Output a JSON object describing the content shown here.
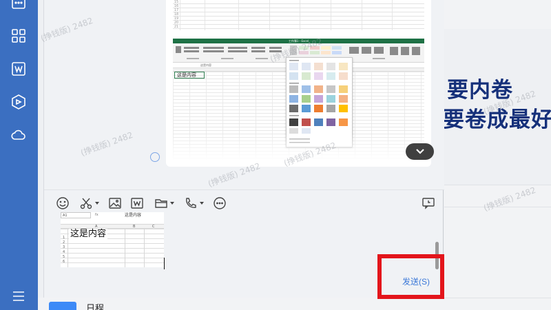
{
  "rail": {
    "icons": [
      "calendar-grid-icon",
      "apps-icon",
      "wps-doc-icon",
      "box-icon",
      "cloud-icon",
      "menu-icon"
    ]
  },
  "history": {
    "image1_rows": [
      "15",
      "16",
      "17",
      "18",
      "19",
      "20",
      "21",
      "22"
    ],
    "image2": {
      "window_title": "工作簿1 - Excel",
      "cell_a1_text": "这是内容",
      "fbar_text": "这是内容"
    }
  },
  "toolbar": {
    "tools": [
      "emoji-icon",
      "scissors-icon",
      "image-icon",
      "word-doc-icon",
      "folder-icon",
      "phone-icon",
      "more-icon",
      "history-chat-icon"
    ]
  },
  "composer": {
    "name_box": "A1",
    "fx": "fx",
    "formula_value": "这是内容",
    "col_headers": [
      "A",
      "B",
      "C"
    ],
    "row_numbers": [
      "1",
      "2",
      "3",
      "4",
      "5",
      "6"
    ],
    "cell_text": "这是内容",
    "send_label": "发送(S)"
  },
  "right_panel": {
    "banner_line1": "要内卷",
    "banner_line2": "要卷成最好"
  },
  "under": {
    "calendar_label": "日程"
  },
  "watermark": "(挣钱版) 2482"
}
